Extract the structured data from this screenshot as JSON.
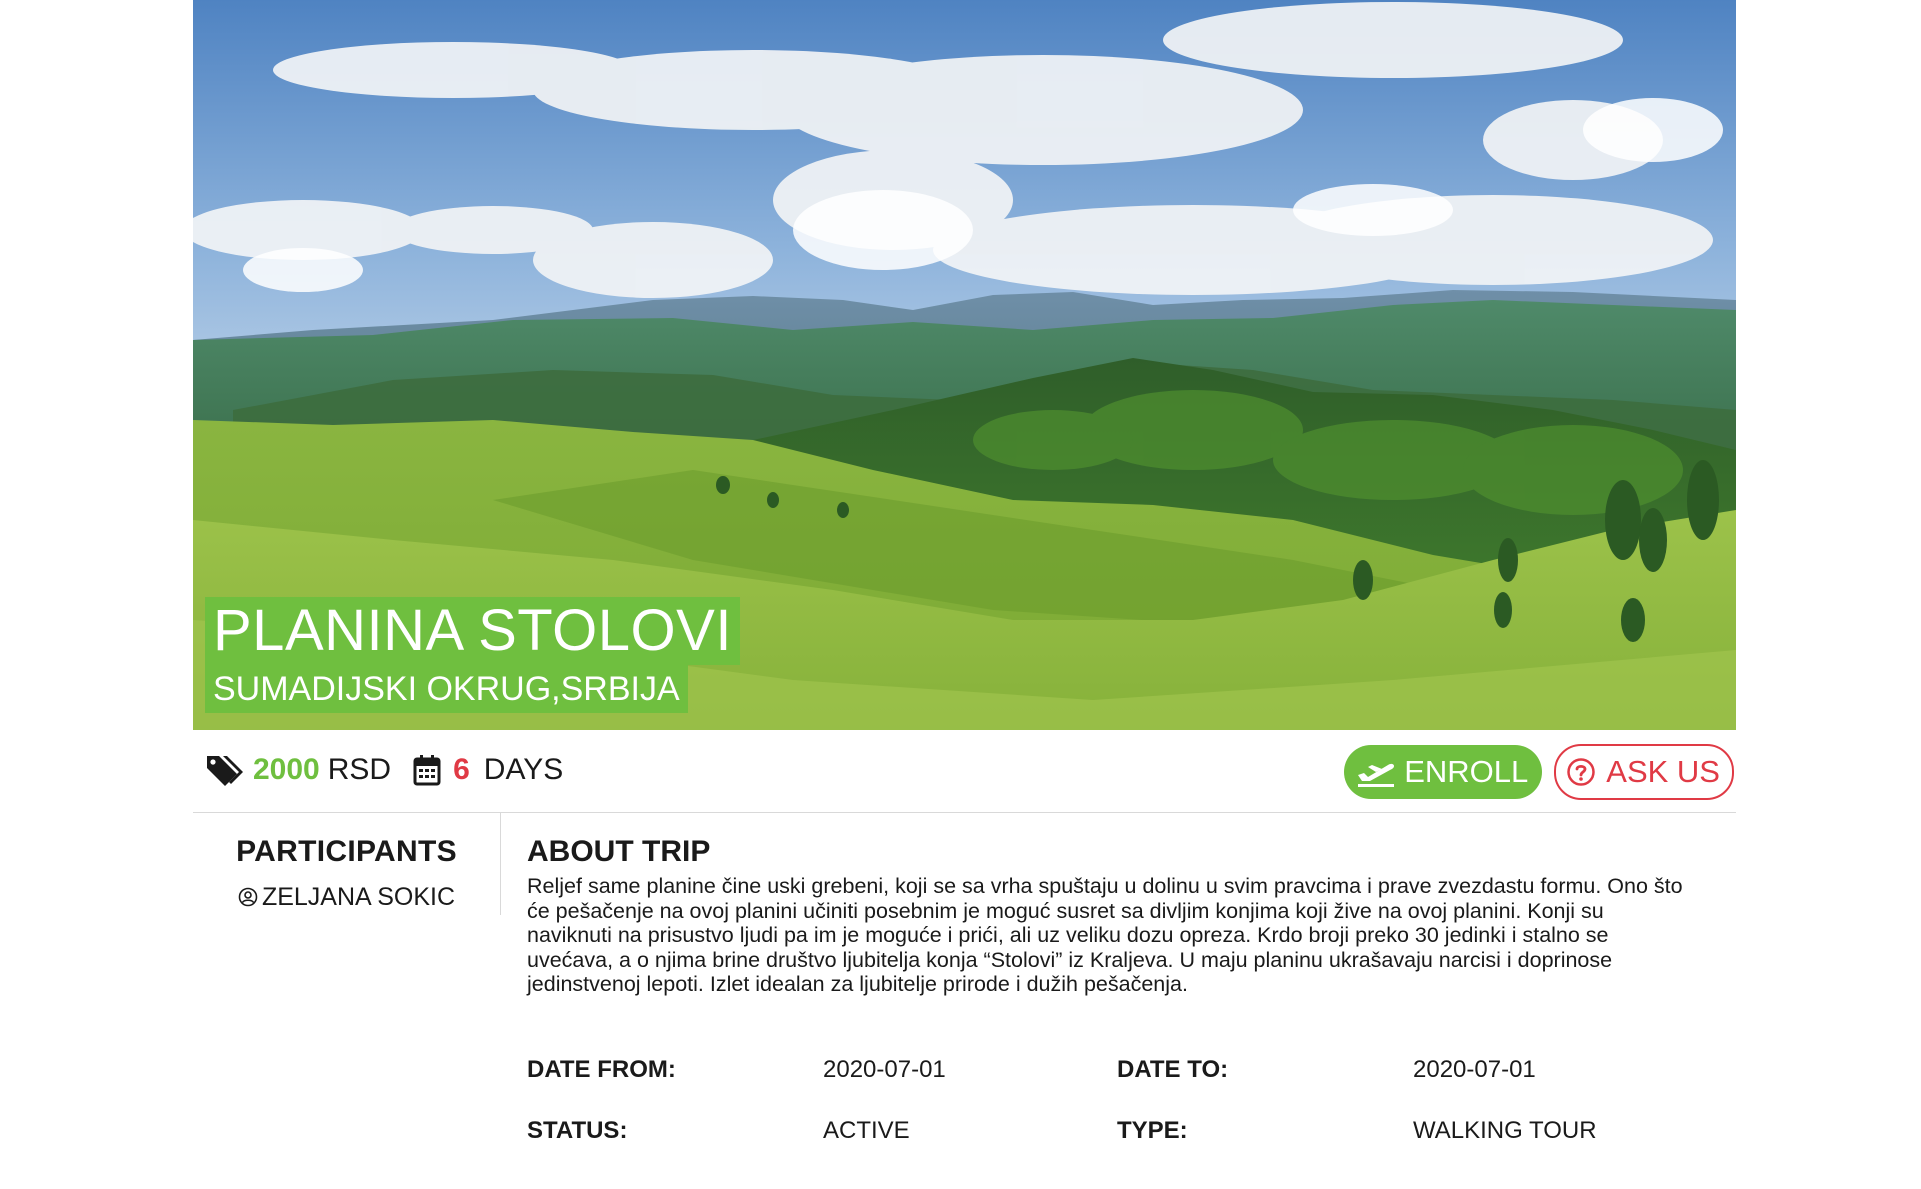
{
  "hero": {
    "title": "PLANINA STOLOVI",
    "subtitle": "SUMADIJSKI OKRUG,SRBIJA",
    "image_alt": "mountain-landscape"
  },
  "info": {
    "price_value": "2000",
    "price_unit": "RSD",
    "days_value": "6",
    "days_unit": "DAYS"
  },
  "actions": {
    "enroll_label": "ENROLL",
    "ask_label": "ASK US"
  },
  "participants": {
    "heading": "PARTICIPANTS",
    "items": [
      {
        "name": "ZELJANA SOKIC",
        "icon": "user-circle-icon"
      }
    ]
  },
  "about": {
    "heading": "ABOUT TRIP",
    "text": "Reljef same planine čine uski grebeni, koji se sa vrha spuštaju u dolinu u svim pravcima i prave zvezdastu formu. Ono što će pešačenje na ovoj planini učiniti posebnim je moguć susret sa divljim konjima koji žive na ovoj planini. Konji su naviknuti na prisustvo ljudi pa im je moguće i prići, ali uz veliku dozu opreza. Krdo broji preko 30 jedinki i stalno se uvećava, a o njima brine društvo ljubitelja konja “Stolovi” iz Kraljeva. U maju planinu ukrašavaju narcisi i doprinose jedinstvenoj lepoti. Izlet idealan za ljubitelje prirode i dužih pešačenja."
  },
  "details": {
    "date_from_label": "DATE FROM:",
    "date_from_value": "2020-07-01",
    "date_to_label": "DATE TO:",
    "date_to_value": "2020-07-01",
    "status_label": "STATUS:",
    "status_value": "ACTIVE",
    "type_label": "TYPE:",
    "type_value": "WALKING TOUR"
  },
  "colors": {
    "accent_green": "#6fbf3f",
    "accent_red": "#e03a45",
    "divider": "#d9d9d9"
  },
  "icons": {
    "price": "tags-icon",
    "days": "calendar-icon",
    "enroll": "plane-departure-icon",
    "ask": "question-circle-icon"
  }
}
